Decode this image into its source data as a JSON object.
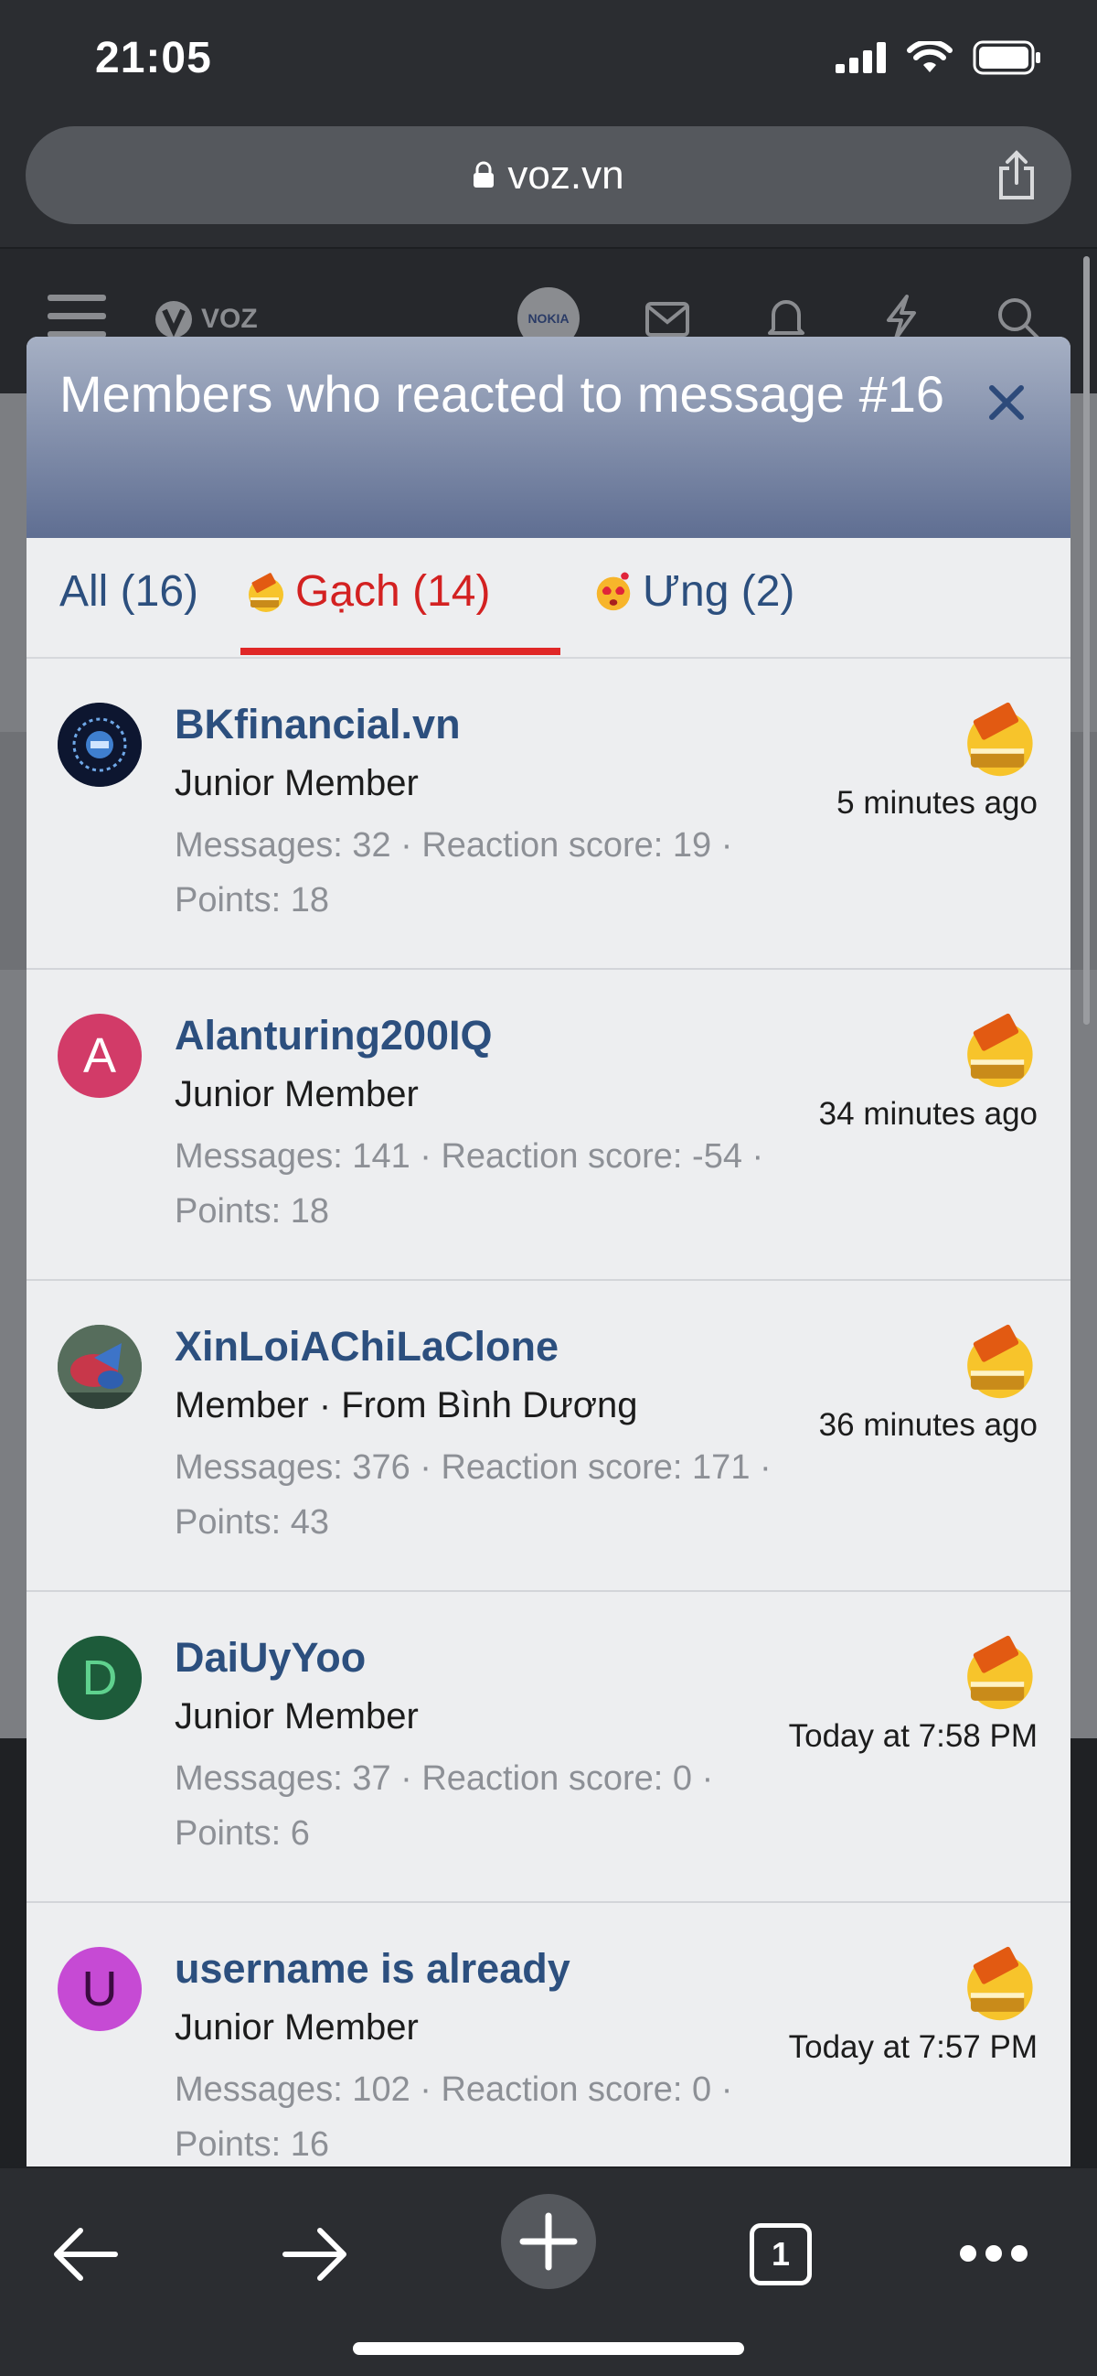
{
  "status_bar": {
    "time": "21:05"
  },
  "browser": {
    "url": "voz.vn"
  },
  "site_header": {
    "logo_text": "VOZ",
    "sponsor_text": "NOKIA"
  },
  "modal": {
    "title": "Members who reacted to message #16",
    "tabs": [
      {
        "label": "All (16)",
        "active": false
      },
      {
        "label": "Gạch (14)",
        "active": true,
        "emoji": "gach"
      },
      {
        "label": "Ưng (2)",
        "active": false,
        "emoji": "ung"
      }
    ],
    "members": [
      {
        "name": "BKfinancial.vn",
        "title": "Junior Member",
        "stats": "Messages: 32 · Reaction score: 19 · Points: 18",
        "time": "5 minutes ago",
        "avatar_letter": "",
        "avatar_color": "#0d1630"
      },
      {
        "name": "Alanturing200IQ",
        "title": "Junior Member",
        "stats": "Messages: 141 · Reaction score: -54 · Points: 18",
        "time": "34 minutes ago",
        "avatar_letter": "A",
        "avatar_color": "#d23b68"
      },
      {
        "name": "XinLoiAChiLaClone",
        "title": "Member · From Bình Dương",
        "stats": "Messages: 376 · Reaction score: 171 · Points: 43",
        "time": "36 minutes ago",
        "avatar_letter": "",
        "avatar_color": "#4a6a52"
      },
      {
        "name": "DaiUyYoo",
        "title": "Junior Member",
        "stats": "Messages: 37 · Reaction score: 0 · Points: 6",
        "time": "Today at 7:58 PM",
        "avatar_letter": "D",
        "avatar_color": "#1d5b3a"
      },
      {
        "name": "username is already",
        "title": "Junior Member",
        "stats": "Messages: 102 · Reaction score: 0 · Points: 16",
        "time": "Today at 7:57 PM",
        "avatar_letter": "U",
        "avatar_color": "#c64ad4"
      }
    ]
  },
  "toolbar": {
    "tab_count": "1"
  },
  "colors": {
    "accent": "#2c4f7e",
    "active_tab": "#e02727",
    "header_gradient_top": "#a6b0c4",
    "header_gradient_bottom": "#5f6e92"
  }
}
